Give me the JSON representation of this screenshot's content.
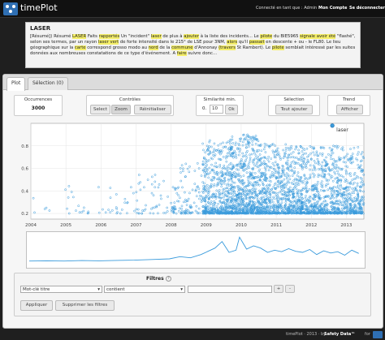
{
  "app": {
    "name": "timePlot"
  },
  "nav": {
    "connected": "Connecté en tant que : Admin",
    "account": "Mon Compte",
    "logout": "Se déconnecter"
  },
  "doc": {
    "title": "LASER",
    "body_parts": [
      {
        "t": "[Résumé]) Résumé ",
        "h": false
      },
      {
        "t": "LASER",
        "h": true
      },
      {
        "t": " Faits ",
        "h": false
      },
      {
        "t": "rapportés",
        "h": true
      },
      {
        "t": " Un \"incident\" ",
        "h": false
      },
      {
        "t": "laser",
        "h": true
      },
      {
        "t": " de plus à ",
        "h": false
      },
      {
        "t": "ajouter",
        "h": true
      },
      {
        "t": " à la liste des incidents... Le ",
        "h": false
      },
      {
        "t": "pilote",
        "h": true
      },
      {
        "t": " du BIE5965 ",
        "h": false
      },
      {
        "t": "signale avoir été",
        "h": true
      },
      {
        "t": " \"flashé\", selon ses termes, par un rayon ",
        "h": false
      },
      {
        "t": "laser vert",
        "h": true
      },
      {
        "t": " de forte intensité dans le 215° de LSE pour 3NM, ",
        "h": false
      },
      {
        "t": "alors",
        "h": true
      },
      {
        "t": " qu'il ",
        "h": false
      },
      {
        "t": "passait",
        "h": true
      },
      {
        "t": " en descente + ou - le FL80. Le lieu géographique sur la ",
        "h": false
      },
      {
        "t": "carte",
        "h": true
      },
      {
        "t": " correspond grosso modo au ",
        "h": false
      },
      {
        "t": "nord",
        "h": true
      },
      {
        "t": " de la ",
        "h": false
      },
      {
        "t": "commune",
        "h": true
      },
      {
        "t": " d'Annonay ",
        "h": false
      },
      {
        "t": "(travers",
        "h": true
      },
      {
        "t": " St Rambert). Le ",
        "h": false
      },
      {
        "t": "pilote",
        "h": true
      },
      {
        "t": " semblait intéressé par les suites données aux nombreuses constatations de ce type d'événement. A ",
        "h": false
      },
      {
        "t": "faire",
        "h": true
      },
      {
        "t": " suivre donc...",
        "h": false
      }
    ]
  },
  "tabs": [
    {
      "label": "Plot"
    },
    {
      "label": "Sélection (0)"
    }
  ],
  "controls": {
    "occurrences_title": "Occurrences",
    "occurrences_value": "3000",
    "controles_title": "Contrôles",
    "select_label": "Select",
    "zoom_label": "Zoom",
    "reset_label": "Réinitialiser",
    "similarite_title": "Similarité min.",
    "similarite_prefix": "0.",
    "similarite_value": "10",
    "ok_label": "Ok",
    "selection_title": "Sélection",
    "select_all_label": "Tout ajouter",
    "trend_title": "Trend",
    "show_label": "Afficher"
  },
  "filters": {
    "title": "Filtres",
    "help": "?",
    "field_value": "Mot-clé titre",
    "op_value": "contient",
    "text_value": "",
    "plus": "+",
    "minus": "-",
    "apply_label": "Appliquer",
    "clear_label": "Supprimer les filtres"
  },
  "footer": {
    "text_left": "timePlot · 2013 · by",
    "brand": "Safety Data™",
    "text_right": "for"
  },
  "chart_data": [
    {
      "type": "scatter",
      "title": "",
      "xlabel": "",
      "ylabel": "",
      "xlim": [
        2004,
        2013.5
      ],
      "ylim": [
        0.15,
        1.0
      ],
      "x_ticks": [
        "2004",
        "2005",
        "2006",
        "2007",
        "2008",
        "2009",
        "2010",
        "2011",
        "2012",
        "2013"
      ],
      "y_ticks": [
        "0.2",
        "0.4",
        "0.6",
        "0.8"
      ],
      "grid": true,
      "point_color": "#3a9bdc",
      "highlight": {
        "x": 2012.6,
        "y": 0.98,
        "label": "laser"
      },
      "density": [
        {
          "from": 2004.0,
          "to": 2004.9,
          "n": 5,
          "ymax": 0.38
        },
        {
          "from": 2004.9,
          "to": 2006.0,
          "n": 18,
          "ymax": 0.45
        },
        {
          "from": 2006.0,
          "to": 2007.0,
          "n": 22,
          "ymax": 0.45
        },
        {
          "from": 2007.0,
          "to": 2008.0,
          "n": 45,
          "ymax": 0.55
        },
        {
          "from": 2008.0,
          "to": 2008.9,
          "n": 110,
          "ymax": 0.65
        },
        {
          "from": 2008.9,
          "to": 2009.6,
          "n": 420,
          "ymax": 0.85
        },
        {
          "from": 2009.6,
          "to": 2010.5,
          "n": 700,
          "ymax": 0.9
        },
        {
          "from": 2010.5,
          "to": 2011.5,
          "n": 620,
          "ymax": 0.82
        },
        {
          "from": 2011.5,
          "to": 2012.5,
          "n": 560,
          "ymax": 0.8
        },
        {
          "from": 2012.5,
          "to": 2013.5,
          "n": 500,
          "ymax": 0.8
        }
      ]
    },
    {
      "type": "line",
      "title": "",
      "xlim": [
        2004,
        2013.5
      ],
      "color": "#3a9bdc",
      "x": [
        2004.0,
        2004.5,
        2005.0,
        2005.5,
        2006.0,
        2006.5,
        2007.0,
        2007.5,
        2008.0,
        2008.3,
        2008.6,
        2008.9,
        2009.1,
        2009.3,
        2009.5,
        2009.7,
        2009.9,
        2010.0,
        2010.2,
        2010.4,
        2010.6,
        2010.8,
        2011.0,
        2011.2,
        2011.4,
        2011.6,
        2011.8,
        2012.0,
        2012.2,
        2012.4,
        2012.6,
        2012.8,
        2013.0,
        2013.2,
        2013.4
      ],
      "y": [
        0.5,
        0.6,
        0.5,
        0.7,
        0.6,
        0.8,
        0.9,
        1.2,
        1.5,
        2.5,
        2.0,
        3.5,
        5.0,
        6.5,
        9.5,
        4.5,
        5.5,
        11.5,
        6.0,
        7.5,
        6.5,
        4.5,
        5.5,
        4.8,
        6.2,
        5.0,
        4.5,
        5.8,
        3.5,
        5.2,
        4.2,
        4.8,
        3.2,
        5.5,
        4.0
      ],
      "ylim": [
        0,
        12
      ]
    }
  ]
}
